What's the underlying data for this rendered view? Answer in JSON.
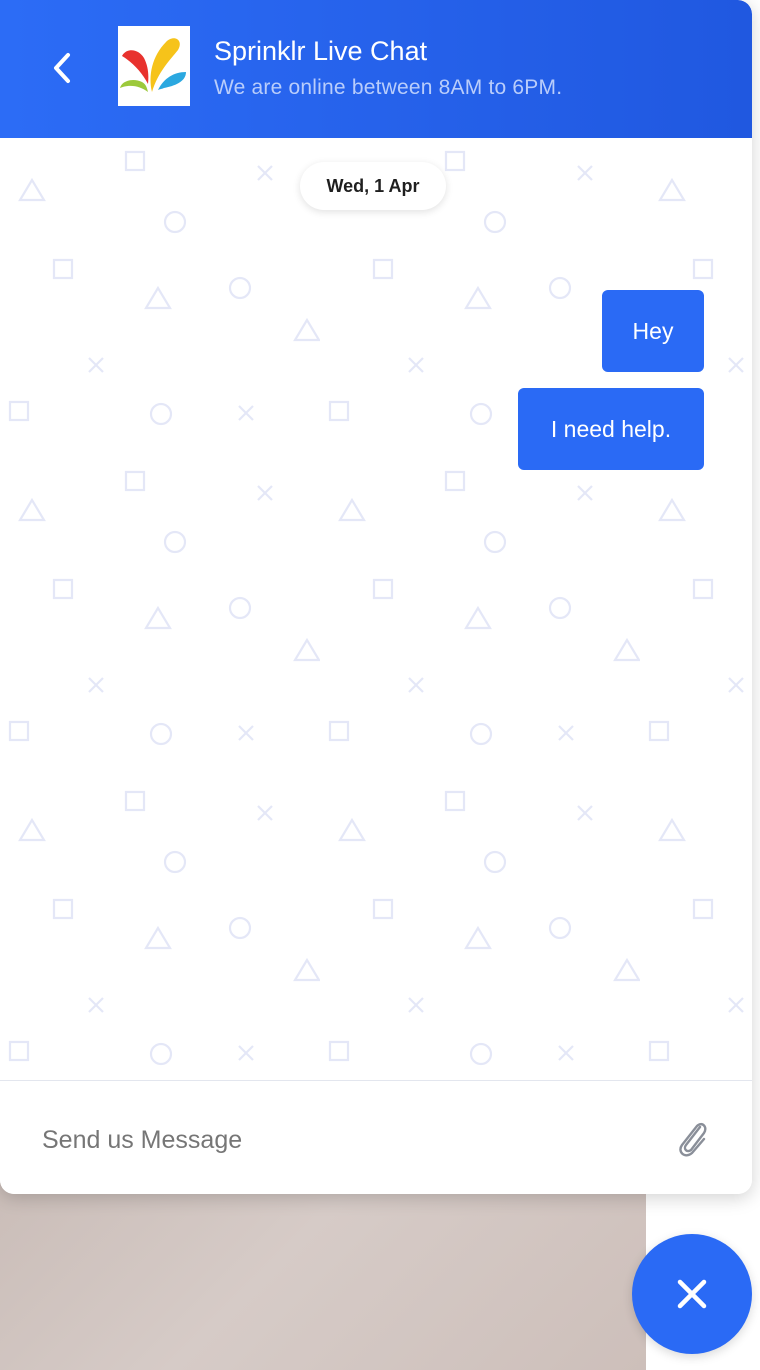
{
  "header": {
    "title": "Sprinklr Live Chat",
    "subtitle": "We are online between 8AM to 6PM.",
    "back_icon": "chevron-left-icon",
    "logo_icon": "sprinklr-logo",
    "accent_color": "#2c6cf6"
  },
  "chat": {
    "date_label": "Wed, 1 Apr",
    "messages": [
      {
        "text": "Hey",
        "direction": "outgoing"
      },
      {
        "text": "I need help.",
        "direction": "outgoing"
      }
    ]
  },
  "composer": {
    "placeholder": "Send us Message",
    "value": "",
    "attach_icon": "paperclip-icon"
  },
  "fab": {
    "icon": "close-icon",
    "color": "#2a6af5"
  }
}
